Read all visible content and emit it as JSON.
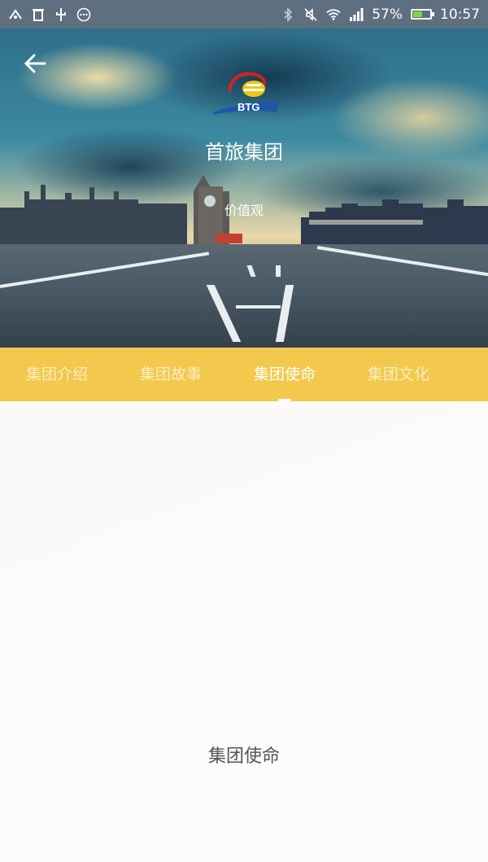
{
  "status_bar": {
    "battery_percent": "57%",
    "time": "10:57",
    "icons": [
      "usb-debug-icon",
      "trash-icon",
      "usb-icon",
      "more-circle-icon",
      "bluetooth-icon",
      "mute-icon",
      "wifi-icon",
      "signal-icon",
      "battery-icon"
    ],
    "battery_level": 0.57
  },
  "header": {
    "company_name": "首旅集团",
    "subtitle": "价值观",
    "logo_text": "BTG"
  },
  "tabs": [
    {
      "label": "集团介绍"
    },
    {
      "label": "集团故事"
    },
    {
      "label": "集团使命",
      "active": true
    },
    {
      "label": "集团文化"
    }
  ],
  "content": {
    "label": "集团使命"
  },
  "colors": {
    "tab_bar": "#f2c94c",
    "status_bar": "#5e6f7f"
  }
}
